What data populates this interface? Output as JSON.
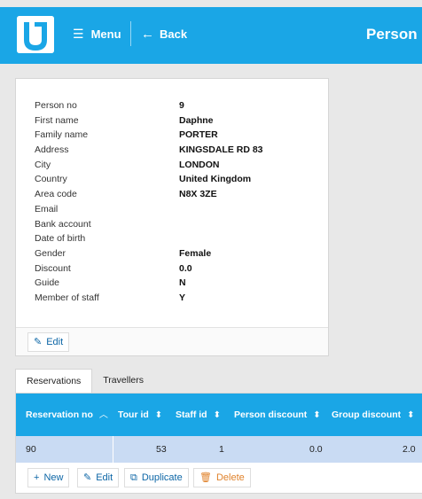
{
  "header": {
    "menu_label": "Menu",
    "back_label": "Back",
    "title": "Person"
  },
  "person": {
    "fields": [
      {
        "label": "Person no",
        "value": "9"
      },
      {
        "label": "First name",
        "value": "Daphne"
      },
      {
        "label": "Family name",
        "value": "PORTER"
      },
      {
        "label": "Address",
        "value": "KINGSDALE RD 83"
      },
      {
        "label": "City",
        "value": "LONDON"
      },
      {
        "label": "Country",
        "value": "United Kingdom"
      },
      {
        "label": "Area code",
        "value": "N8X 3ZE"
      },
      {
        "label": "Email",
        "value": ""
      },
      {
        "label": "Bank account",
        "value": ""
      },
      {
        "label": "Date of birth",
        "value": ""
      },
      {
        "label": "Gender",
        "value": "Female"
      },
      {
        "label": "Discount",
        "value": "0.0"
      },
      {
        "label": "Guide",
        "value": "N"
      },
      {
        "label": "Member of staff",
        "value": "Y"
      }
    ],
    "edit_label": "Edit"
  },
  "tabs": [
    {
      "label": "Reservations",
      "active": true
    },
    {
      "label": "Travellers",
      "active": false
    }
  ],
  "reservations": {
    "columns": [
      "Reservation no",
      "Tour id",
      "Staff id",
      "Person discount",
      "Group discount"
    ],
    "rows": [
      [
        "90",
        "53",
        "1",
        "0.0",
        "2.0"
      ]
    ],
    "actions": {
      "new": "New",
      "edit": "Edit",
      "duplicate": "Duplicate",
      "delete": "Delete"
    }
  },
  "colors": {
    "accent": "#1aa6e6",
    "selected_row": "#c9dbf3",
    "link": "#0c66a6",
    "delete": "#e0822b"
  }
}
